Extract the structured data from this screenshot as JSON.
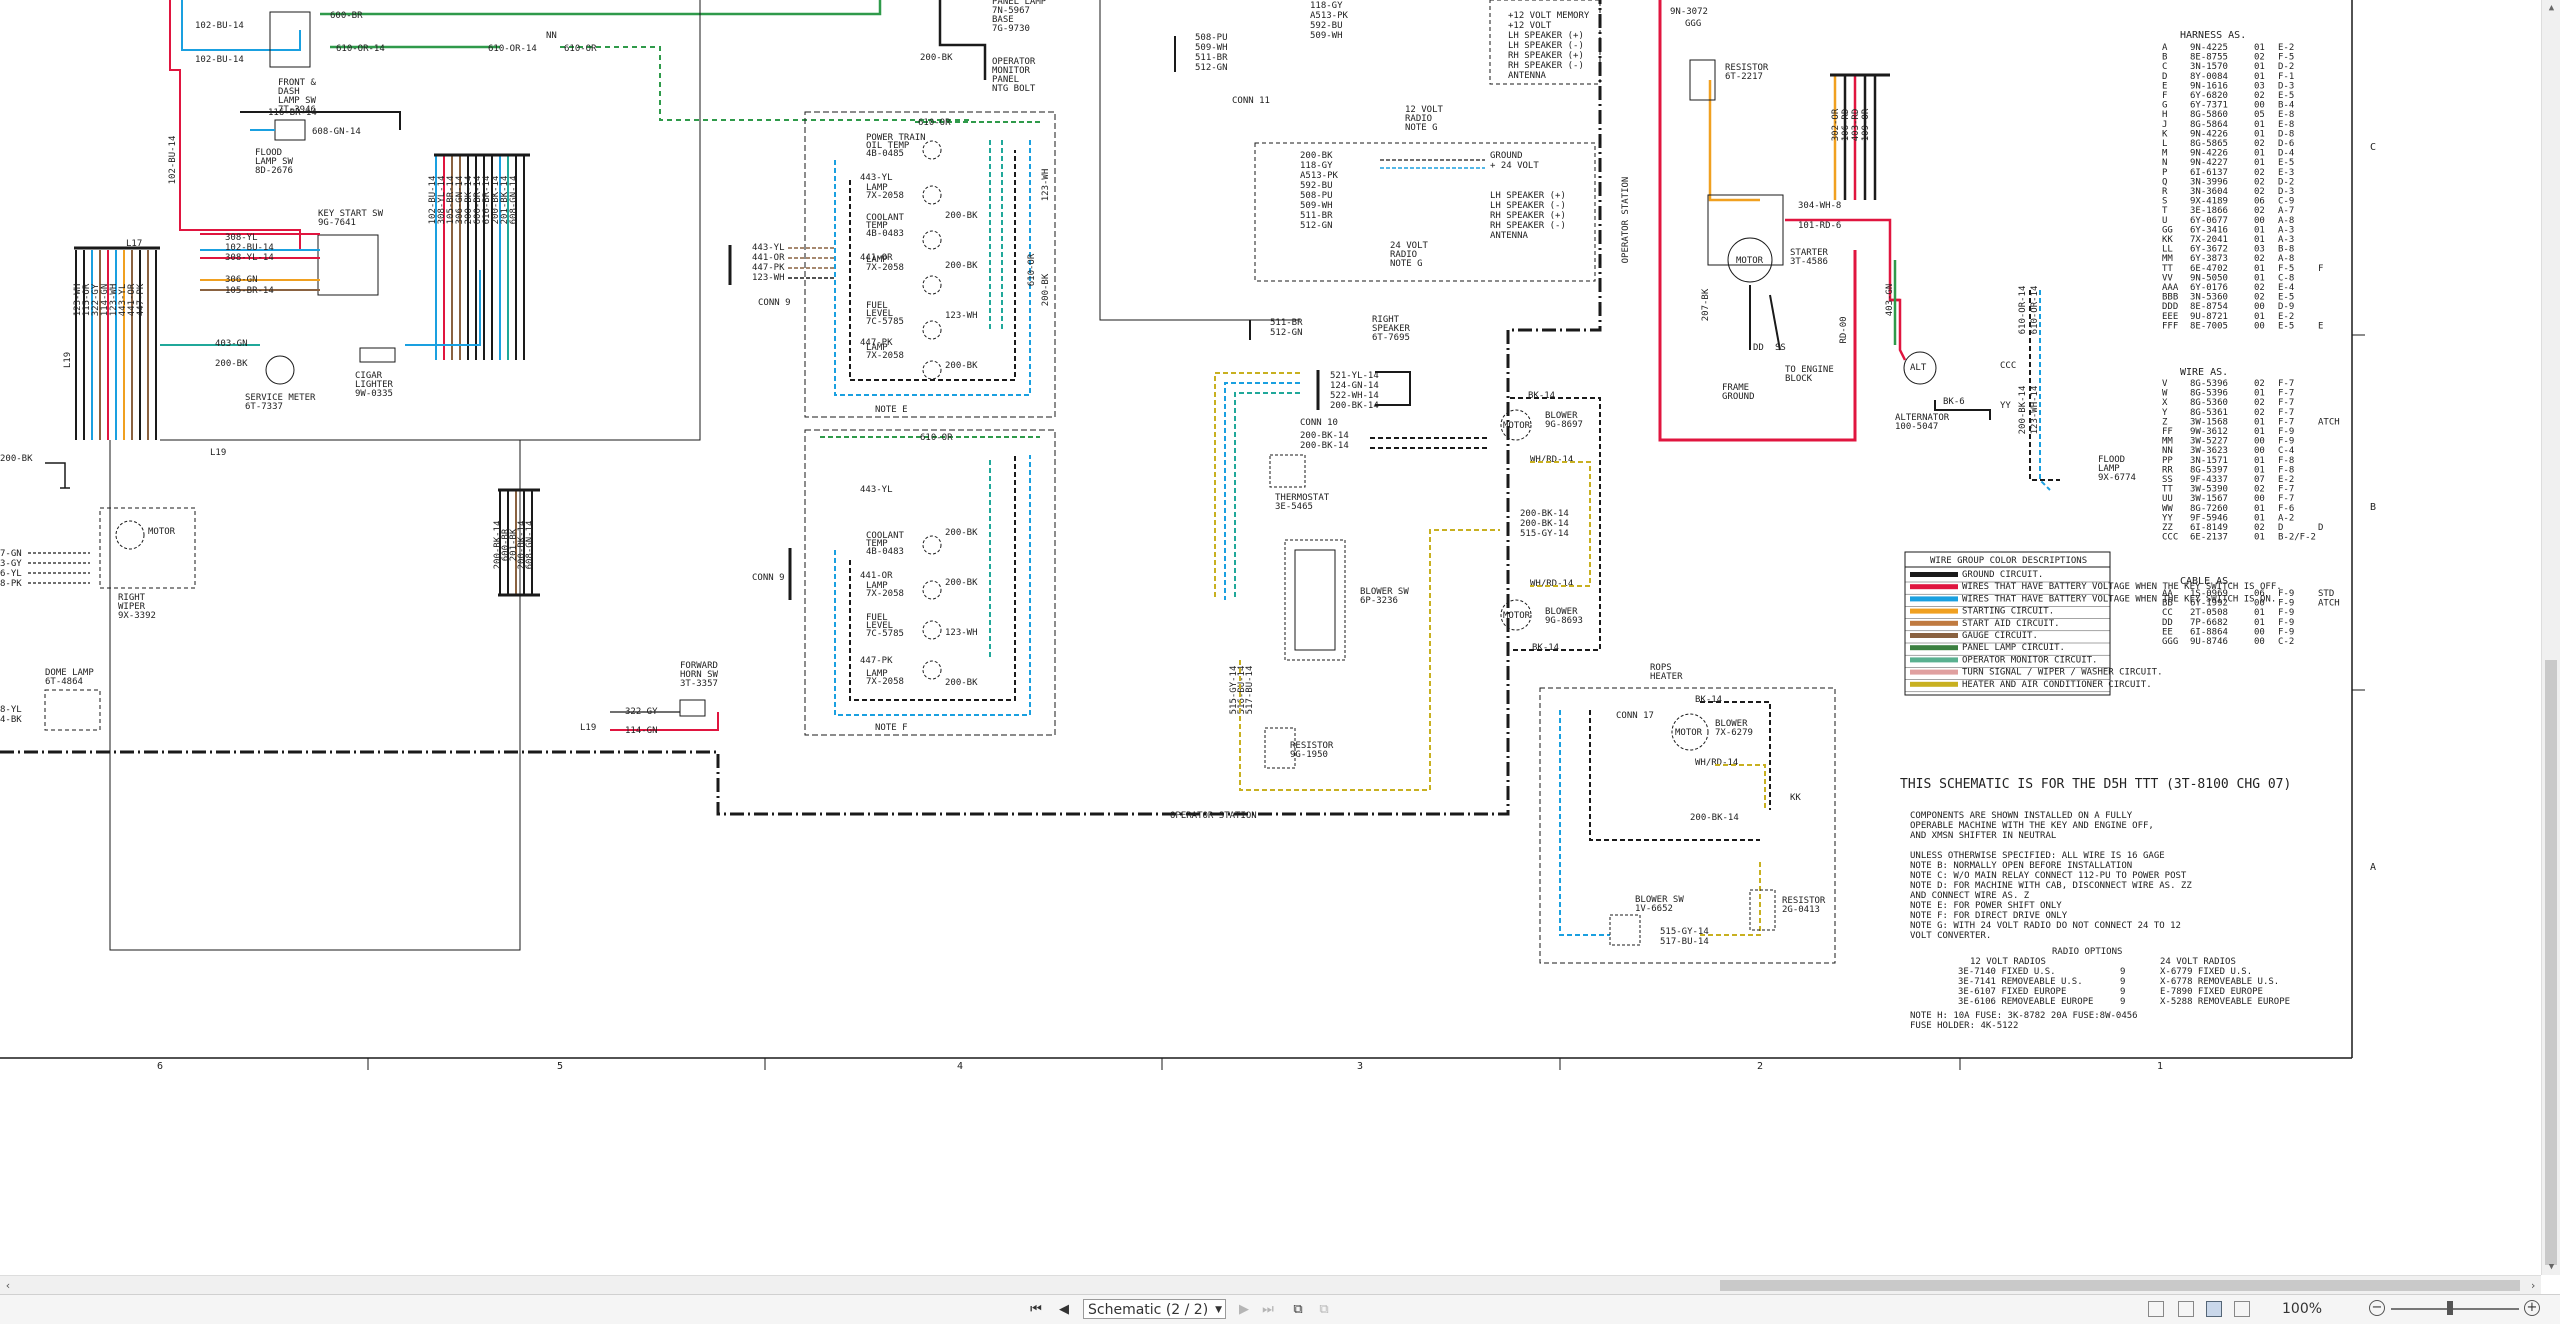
{
  "schematic": {
    "harness_title": "HARNESS AS.",
    "harness": [
      [
        "A",
        "9N-4225",
        "01",
        "E-2"
      ],
      [
        "B",
        "8E-8755",
        "02",
        "F-5"
      ],
      [
        "C",
        "3N-1570",
        "01",
        "D-2"
      ],
      [
        "D",
        "8Y-0084",
        "01",
        "F-1"
      ],
      [
        "E",
        "9N-1616",
        "03",
        "D-3"
      ],
      [
        "F",
        "6Y-6820",
        "02",
        "E-5"
      ],
      [
        "G",
        "6Y-7371",
        "00",
        "B-4"
      ],
      [
        "H",
        "8G-5860",
        "05",
        "E-8"
      ],
      [
        "J",
        "8G-5864",
        "01",
        "E-8"
      ],
      [
        "K",
        "9N-4226",
        "01",
        "D-8"
      ],
      [
        "L",
        "8G-5865",
        "02",
        "D-6"
      ],
      [
        "M",
        "9N-4226",
        "01",
        "D-4"
      ],
      [
        "N",
        "9N-4227",
        "01",
        "E-5"
      ],
      [
        "P",
        "6I-6137",
        "02",
        "E-3"
      ],
      [
        "Q",
        "3N-3996",
        "02",
        "D-2"
      ],
      [
        "R",
        "3N-3604",
        "02",
        "D-3"
      ],
      [
        "S",
        "9X-4189",
        "06",
        "C-9"
      ],
      [
        "T",
        "3E-1866",
        "02",
        "A-7"
      ],
      [
        "U",
        "6Y-0677",
        "00",
        "A-8"
      ],
      [
        "GG",
        "6Y-3416",
        "01",
        "A-3"
      ],
      [
        "KK",
        "7X-2041",
        "01",
        "A-3"
      ],
      [
        "LL",
        "6Y-3672",
        "03",
        "B-8"
      ],
      [
        "MM",
        "6Y-3873",
        "02",
        "A-8"
      ],
      [
        "TT",
        "6E-4702",
        "01",
        "F-5"
      ],
      [
        "VV",
        "9N-5050",
        "01",
        "C-8"
      ],
      [
        "AAA",
        "6Y-0176",
        "02",
        "E-4"
      ],
      [
        "BBB",
        "3N-5360",
        "02",
        "E-5"
      ],
      [
        "DDD",
        "8E-8754",
        "00",
        "D-9"
      ],
      [
        "EEE",
        "9U-8721",
        "01",
        "E-2"
      ],
      [
        "FFF",
        "8E-7005",
        "00",
        "E-5"
      ]
    ],
    "harness_notes": {
      "TT": "F",
      "FFF": "E"
    },
    "wire_title": "WIRE AS.",
    "wires": [
      [
        "V",
        "8G-5396",
        "02",
        "F-7"
      ],
      [
        "W",
        "8G-5396",
        "01",
        "F-7"
      ],
      [
        "X",
        "8G-5360",
        "02",
        "F-7"
      ],
      [
        "Y",
        "8G-5361",
        "02",
        "F-7"
      ],
      [
        "Z",
        "3W-1568",
        "01",
        "F-7"
      ],
      [
        "FF",
        "9W-3612",
        "01",
        "F-9"
      ],
      [
        "MM",
        "3W-5227",
        "00",
        "F-9"
      ],
      [
        "NN",
        "3W-3623",
        "00",
        "C-4"
      ],
      [
        "PP",
        "3N-1571",
        "01",
        "F-8"
      ],
      [
        "RR",
        "8G-5397",
        "01",
        "F-8"
      ],
      [
        "SS",
        "9F-4337",
        "07",
        "E-2"
      ],
      [
        "TT",
        "3W-5390",
        "02",
        "F-7"
      ],
      [
        "UU",
        "3W-1567",
        "00",
        "F-7"
      ],
      [
        "WW",
        "8G-7260",
        "01",
        "F-6"
      ],
      [
        "YY",
        "9F-5946",
        "01",
        "A-2"
      ],
      [
        "ZZ",
        "6I-8149",
        "02",
        "D"
      ],
      [
        "CCC",
        "6E-2137",
        "01",
        "B-2/F-2"
      ]
    ],
    "wire_notes": {
      "Z": "ATCH",
      "ZZ": "D"
    },
    "cable_title": "CABLE AS.",
    "cables": [
      [
        "AA",
        "1S-0969",
        "06",
        "F-9"
      ],
      [
        "BB",
        "6Y-1992",
        "00",
        "F-9"
      ],
      [
        "CC",
        "2T-0508",
        "01",
        "F-9"
      ],
      [
        "DD",
        "7P-6682",
        "01",
        "F-9"
      ],
      [
        "EE",
        "6I-8864",
        "00",
        "F-9"
      ],
      [
        "GGG",
        "9U-8746",
        "00",
        "C-2"
      ]
    ],
    "cable_notes": {
      "AA": "STD",
      "BB": "ATCH"
    },
    "legend_title": "WIRE GROUP COLOR DESCRIPTIONS",
    "legend": [
      {
        "color": "#1a1a1a",
        "text": "GROUND CIRCUIT."
      },
      {
        "color": "#e0153f",
        "text": "WIRES THAT HAVE BATTERY VOLTAGE WHEN THE KEY SWITCH IS OFF."
      },
      {
        "color": "#1aa0e0",
        "text": "WIRES THAT HAVE BATTERY VOLTAGE WHEN THE KEY SWITCH IS ON."
      },
      {
        "color": "#f0a020",
        "text": "STARTING CIRCUIT."
      },
      {
        "color": "#c07a40",
        "text": "START AID CIRCUIT."
      },
      {
        "color": "#8a6240",
        "text": "GAUGE CIRCUIT."
      },
      {
        "color": "#3c8040",
        "text": "PANEL LAMP CIRCUIT."
      },
      {
        "color": "#5ab090",
        "text": "OPERATOR MONITOR CIRCUIT."
      },
      {
        "color": "#e0a0a0",
        "text": "TURN SIGNAL / WIPER / WASHER CIRCUIT."
      },
      {
        "color": "#c8b020",
        "text": "HEATER AND AIR CONDITIONER CIRCUIT."
      }
    ],
    "schem_title": "THIS SCHEMATIC IS FOR THE D5H TTT (3T-8100 CHG 07)",
    "notes": [
      "COMPONENTS ARE SHOWN INSTALLED ON A FULLY",
      "OPERABLE MACHINE WITH THE KEY AND ENGINE OFF,",
      "AND XMSN SHIFTER IN NEUTRAL",
      "",
      "UNLESS OTHERWISE SPECIFIED: ALL WIRE IS 16 GAGE",
      "NOTE B: NORMALLY OPEN BEFORE INSTALLATION",
      "NOTE C: W/O MAIN RELAY CONNECT 112-PU TO POWER POST",
      "NOTE D: FOR MACHINE WITH CAB, DISCONNECT WIRE AS. ZZ",
      "        AND CONNECT WIRE AS. Z",
      "NOTE E: FOR POWER SHIFT ONLY",
      "NOTE F: FOR DIRECT DRIVE ONLY",
      "NOTE G: WITH 24 VOLT RADIO DO NOT CONNECT 24 TO 12",
      "        VOLT CONVERTER."
    ],
    "radio_title": "RADIO OPTIONS",
    "radio_12_title": "12 VOLT RADIOS",
    "radio_24_title": "24 VOLT RADIOS",
    "radio_12": [
      [
        "3E-7140 FIXED U.S.",
        "9"
      ],
      [
        "3E-7141 REMOVEABLE U.S.",
        "9"
      ],
      [
        "3E-6107 FIXED EUROPE",
        "9"
      ],
      [
        "3E-6106 REMOVEABLE EUROPE",
        "9"
      ]
    ],
    "radio_24": [
      "X-6779 FIXED U.S.",
      "X-6778 REMOVEABLE U.S.",
      "E-7890 FIXED EUROPE",
      "X-5288 REMOVEABLE EUROPE"
    ],
    "note_h": "NOTE H: 10A FUSE: 3K-8782  20A FUSE:8W-0456",
    "note_h2": "        FUSE HOLDER: 4K-5122",
    "zone_numbers": [
      "6",
      "5",
      "4",
      "3",
      "2",
      "1"
    ],
    "zone_letters": [
      "C",
      "B",
      "A"
    ],
    "components": {
      "front_dash": [
        "FRONT &",
        "DASH",
        "LAMP SW",
        "7T-3946"
      ],
      "flood_lamp_sw": [
        "FLOOD",
        "LAMP SW",
        "8D-2676"
      ],
      "key_start": [
        "KEY START SW",
        "9G-7641"
      ],
      "service_meter": [
        "SERVICE METER",
        "6T-7337"
      ],
      "cigar": [
        "CIGAR",
        "LIGHTER",
        "9W-0335"
      ],
      "right_wiper": [
        "RIGHT",
        "WIPER",
        "9X-3392"
      ],
      "dome_lamp": [
        "DOME LAMP",
        "6T-4864"
      ],
      "horn_sw": [
        "FORWARD",
        "HORN SW",
        "3T-3357"
      ],
      "op_monitor": [
        "OPERATOR",
        "MONITOR",
        "PANEL",
        "NTG BOLT"
      ],
      "panel_lamp": [
        "PANEL LAMP",
        "7N-5967",
        "BASE",
        "7G-9730"
      ],
      "radio12": [
        "12 VOLT",
        "RADIO",
        "NOTE G"
      ],
      "radio24": [
        "24 VOLT",
        "RADIO",
        "NOTE G"
      ],
      "right_speaker": [
        "RIGHT",
        "SPEAKER",
        "6T-7695"
      ],
      "thermostat": [
        "THERMOSTAT",
        "3E-5465"
      ],
      "blower_sw": [
        "BLOWER SW",
        "6P-3236"
      ],
      "resistor_a": [
        "RESISTOR",
        "9G-1950"
      ],
      "blower_a": [
        "BLOWER",
        "9G-8697"
      ],
      "blower_b": [
        "BLOWER",
        "9G-8693"
      ],
      "rops": [
        "ROPS",
        "HEATER"
      ],
      "blower_c": [
        "BLOWER",
        "7X-6279"
      ],
      "blower_sw_b": [
        "BLOWER SW",
        "1V-6652"
      ],
      "resistor_b": [
        "RESISTOR",
        "2G-0413"
      ],
      "resistor_top": [
        "RESISTOR",
        "6T-2217"
      ],
      "starter": [
        "STARTER",
        "3T-4586"
      ],
      "alternator": [
        "ALTERNATOR",
        "100-5047"
      ],
      "frame_ground": [
        "FRAME",
        "GROUND"
      ],
      "engine_block": [
        "TO ENGINE",
        "BLOCK"
      ],
      "flood_lamp": [
        "FLOOD",
        "LAMP",
        "9X-6774"
      ],
      "note_e": "NOTE E",
      "note_f": "NOTE F",
      "operator_station": "OPERATOR STATION",
      "operator_station_v": "OPERATOR STATION",
      "conn9a": "CONN 9",
      "conn9b": "CONN 9",
      "conn10": "CONN 10",
      "conn11": "CONN 11",
      "conn17": "CONN 17",
      "gauge_block": [
        "POWER TRAIN",
        "OIL TEMP",
        "4B-0485",
        "LAMP",
        "7X-2058",
        "COOLANT",
        "TEMP",
        "4B-0483",
        "LAMP",
        "7X-2058",
        "FUEL",
        "LEVEL",
        "7C-5785",
        "LAMP",
        "7X-2058"
      ],
      "gauge_block2": [
        "COOLANT",
        "TEMP",
        "4B-0483",
        "LAMP",
        "7X-2058",
        "FUEL",
        "LEVEL",
        "7C-5785",
        "LAMP",
        "7X-2058"
      ]
    }
  },
  "statusbar": {
    "page_label": "Schematic (2 / 2)",
    "zoom": "100%"
  }
}
